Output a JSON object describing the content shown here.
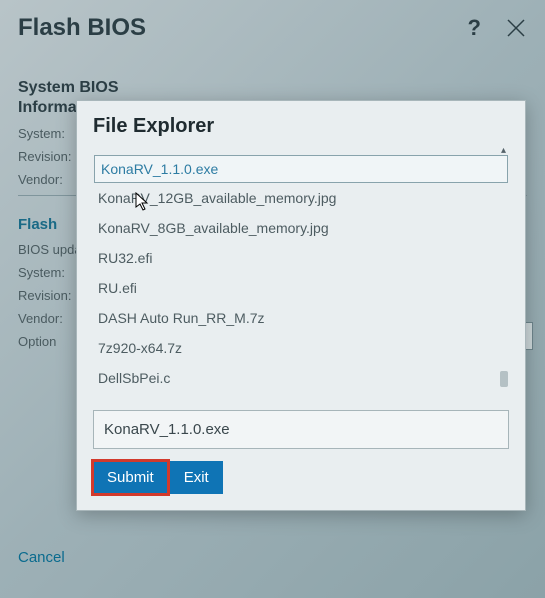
{
  "bg": {
    "title": "Flash BIOS",
    "help": "?",
    "section1_line1": "System BIOS",
    "section1_line2": "Information",
    "labels": {
      "system": "System:",
      "revision": "Revision:",
      "vendor": "Vendor:",
      "bios_update": "BIOS update:",
      "system2": "System:",
      "revision2": "Revision:",
      "vendor2": "Vendor:",
      "option": "Option"
    },
    "flash_header": "Flash",
    "cancel": "Cancel"
  },
  "dialog": {
    "title": "File Explorer",
    "files": [
      "KonaRV_1.1.0.exe",
      "KonaRV_12GB_available_memory.jpg",
      "KonaRV_8GB_available_memory.jpg",
      "RU32.efi",
      "RU.efi",
      "DASH Auto Run_RR_M.7z",
      "7z920-x64.7z",
      "DellSbPei.c"
    ],
    "selected_file": "KonaRV_1.1.0.exe",
    "submit": "Submit",
    "exit": "Exit"
  }
}
